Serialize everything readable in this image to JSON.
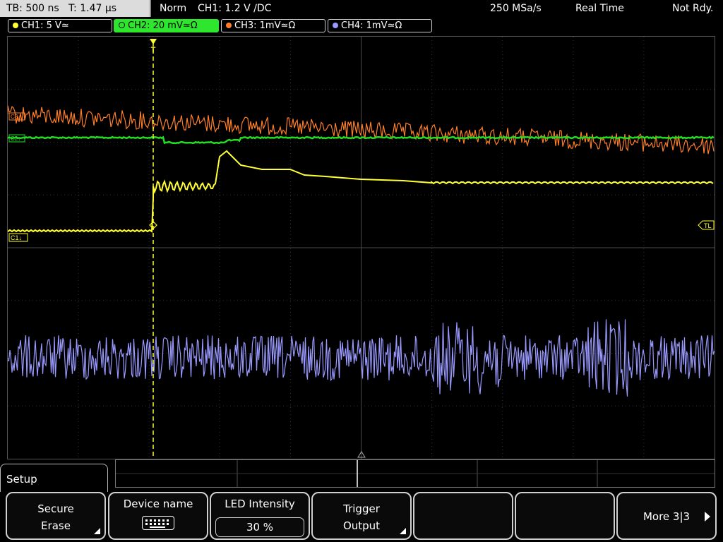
{
  "status": {
    "timebase": "TB: 500 ns",
    "trig_pos": "T: 1.47 µs",
    "mode": "Norm",
    "trigger": "CH1: 1.2 V ∕DC",
    "sample_rate": "250 MSa/s",
    "acq_mode": "Real Time",
    "state": "Not Rdy."
  },
  "channels": [
    {
      "label": "CH1: 5 V≃",
      "color": "#ffff33",
      "active": false
    },
    {
      "label": "CH2: 20 mV≃Ω",
      "color": "#22dd22",
      "active": true
    },
    {
      "label": "CH3: 1mV≃Ω",
      "color": "#ff7f2a",
      "active": false
    },
    {
      "label": "CH4: 1mV≃Ω",
      "color": "#9999ff",
      "active": false
    }
  ],
  "screen": {
    "ch1_marker": "C1↓",
    "ch2_marker": "C2↓",
    "ch3_marker": "C3↓",
    "trigger_level_marker": "TL",
    "trigger_marker": "T"
  },
  "menu": {
    "title": "Setup",
    "softkeys": [
      {
        "line1": "Secure",
        "line2": "Erase"
      },
      {
        "line1": "Device name",
        "icon": "keyboard-icon"
      },
      {
        "line1": "LED Intensity",
        "value": "30 %"
      },
      {
        "line1": "Trigger",
        "line2": "Output"
      },
      {
        "line1": ""
      },
      {
        "line1": ""
      },
      {
        "line1": "More 3|3"
      }
    ]
  }
}
